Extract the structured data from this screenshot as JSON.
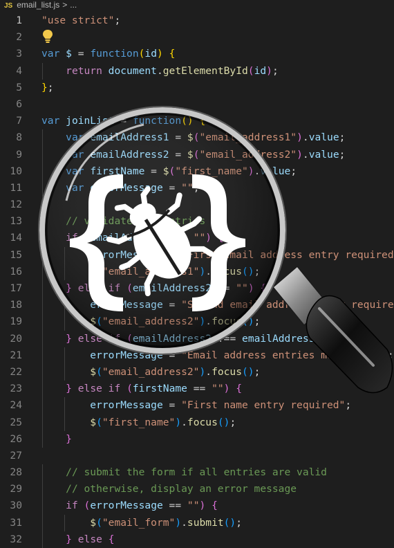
{
  "tab": {
    "lang_badge": "JS",
    "filename": "email_list.js",
    "chevron": ">",
    "breadcrumb_more": "..."
  },
  "icons": {
    "lightbulb": "lightbulb-icon",
    "magnifier": "magnifying-glass-icon",
    "bug": "bug-icon",
    "braces": "curly-braces-icon"
  },
  "colors": {
    "background": "#1e1e1e",
    "string": "#ce9178",
    "keyword": "#569cd6",
    "control": "#c586c0",
    "function": "#dcdcaa",
    "variable": "#9cdcfe",
    "comment": "#6a9955",
    "bracket1": "#ffd700",
    "bracket2": "#da70d6",
    "bracket3": "#179fff"
  },
  "editor": {
    "active_line": 1,
    "lines": [
      {
        "n": "1",
        "t": [
          [
            "str",
            "\"use strict\""
          ],
          [
            "pn",
            ";"
          ]
        ]
      },
      {
        "n": "2",
        "t": []
      },
      {
        "n": "3",
        "t": [
          [
            "kw",
            "var"
          ],
          [
            "pn",
            " "
          ],
          [
            "var",
            "$"
          ],
          [
            "pn",
            " = "
          ],
          [
            "kw",
            "function"
          ],
          [
            "br1",
            "("
          ],
          [
            "var",
            "id"
          ],
          [
            "br1",
            ")"
          ],
          [
            "pn",
            " "
          ],
          [
            "br1",
            "{"
          ]
        ]
      },
      {
        "n": "4",
        "t": [
          [
            "pn",
            "    "
          ],
          [
            "ctl",
            "return"
          ],
          [
            "pn",
            " "
          ],
          [
            "var",
            "document"
          ],
          [
            "pn",
            "."
          ],
          [
            "fn",
            "getElementById"
          ],
          [
            "br2",
            "("
          ],
          [
            "var",
            "id"
          ],
          [
            "br2",
            ")"
          ],
          [
            "pn",
            ";"
          ]
        ]
      },
      {
        "n": "5",
        "t": [
          [
            "br1",
            "}"
          ],
          [
            "pn",
            ";"
          ]
        ]
      },
      {
        "n": "6",
        "t": []
      },
      {
        "n": "7",
        "t": [
          [
            "kw",
            "var"
          ],
          [
            "pn",
            " "
          ],
          [
            "var",
            "joinList"
          ],
          [
            "pn",
            " = "
          ],
          [
            "kw",
            "function"
          ],
          [
            "br1",
            "()"
          ],
          [
            "pn",
            " "
          ],
          [
            "br1",
            "{"
          ]
        ]
      },
      {
        "n": "8",
        "t": [
          [
            "pn",
            "    "
          ],
          [
            "kw",
            "var"
          ],
          [
            "pn",
            " "
          ],
          [
            "var",
            "emailAddress1"
          ],
          [
            "pn",
            " = "
          ],
          [
            "fn",
            "$"
          ],
          [
            "br2",
            "("
          ],
          [
            "str",
            "\"email_address1\""
          ],
          [
            "br2",
            ")"
          ],
          [
            "pn",
            "."
          ],
          [
            "var",
            "value"
          ],
          [
            "pn",
            ";"
          ]
        ]
      },
      {
        "n": "9",
        "t": [
          [
            "pn",
            "    "
          ],
          [
            "kw",
            "var"
          ],
          [
            "pn",
            " "
          ],
          [
            "var",
            "emailAddress2"
          ],
          [
            "pn",
            " = "
          ],
          [
            "fn",
            "$"
          ],
          [
            "br2",
            "("
          ],
          [
            "str",
            "\"email_address2\""
          ],
          [
            "br2",
            ")"
          ],
          [
            "pn",
            "."
          ],
          [
            "var",
            "value"
          ],
          [
            "pn",
            ";"
          ]
        ]
      },
      {
        "n": "10",
        "t": [
          [
            "pn",
            "    "
          ],
          [
            "kw",
            "var"
          ],
          [
            "pn",
            " "
          ],
          [
            "var",
            "firstName"
          ],
          [
            "pn",
            " = "
          ],
          [
            "fn",
            "$"
          ],
          [
            "br2",
            "("
          ],
          [
            "str",
            "\"first_name\""
          ],
          [
            "br2",
            ")"
          ],
          [
            "pn",
            "."
          ],
          [
            "var",
            "value"
          ],
          [
            "pn",
            ";"
          ]
        ]
      },
      {
        "n": "11",
        "t": [
          [
            "pn",
            "    "
          ],
          [
            "kw",
            "var"
          ],
          [
            "pn",
            " "
          ],
          [
            "var",
            "errorMessage"
          ],
          [
            "pn",
            " = "
          ],
          [
            "str",
            "\"\""
          ],
          [
            "pn",
            ";"
          ]
        ]
      },
      {
        "n": "12",
        "t": []
      },
      {
        "n": "13",
        "t": [
          [
            "pn",
            "    "
          ],
          [
            "com",
            "// validate the entries"
          ]
        ]
      },
      {
        "n": "14",
        "t": [
          [
            "pn",
            "    "
          ],
          [
            "ctl",
            "if"
          ],
          [
            "pn",
            " "
          ],
          [
            "br2",
            "("
          ],
          [
            "var",
            "emailAddress1"
          ],
          [
            "pn",
            " == "
          ],
          [
            "str",
            "\"\""
          ],
          [
            "br2",
            ")"
          ],
          [
            "pn",
            " "
          ],
          [
            "br2",
            "{"
          ]
        ]
      },
      {
        "n": "15",
        "t": [
          [
            "pn",
            "        "
          ],
          [
            "var",
            "errorMessage"
          ],
          [
            "pn",
            " = "
          ],
          [
            "str",
            "\"First email address entry required\""
          ],
          [
            "pn",
            ";"
          ]
        ]
      },
      {
        "n": "16",
        "t": [
          [
            "pn",
            "        "
          ],
          [
            "fn",
            "$"
          ],
          [
            "br3",
            "("
          ],
          [
            "str",
            "\"email_address1\""
          ],
          [
            "br3",
            ")"
          ],
          [
            "pn",
            "."
          ],
          [
            "fn",
            "focus"
          ],
          [
            "br3",
            "()"
          ],
          [
            "pn",
            ";"
          ]
        ]
      },
      {
        "n": "17",
        "t": [
          [
            "pn",
            "    "
          ],
          [
            "br2",
            "}"
          ],
          [
            "pn",
            " "
          ],
          [
            "ctl",
            "else if"
          ],
          [
            "pn",
            " "
          ],
          [
            "br2",
            "("
          ],
          [
            "var",
            "emailAddress2"
          ],
          [
            "pn",
            " == "
          ],
          [
            "str",
            "\"\""
          ],
          [
            "br2",
            ")"
          ],
          [
            "pn",
            " "
          ],
          [
            "br2",
            "{"
          ]
        ]
      },
      {
        "n": "18",
        "t": [
          [
            "pn",
            "        "
          ],
          [
            "var",
            "errorMessage"
          ],
          [
            "pn",
            " = "
          ],
          [
            "str",
            "\"Second email address entry required\""
          ],
          [
            "pn",
            ";"
          ]
        ]
      },
      {
        "n": "19",
        "t": [
          [
            "pn",
            "        "
          ],
          [
            "fn",
            "$"
          ],
          [
            "br3",
            "("
          ],
          [
            "str",
            "\"email_address2\""
          ],
          [
            "br3",
            ")"
          ],
          [
            "pn",
            "."
          ],
          [
            "fn",
            "focus"
          ],
          [
            "br3",
            "()"
          ],
          [
            "pn",
            ";"
          ]
        ]
      },
      {
        "n": "20",
        "t": [
          [
            "pn",
            "    "
          ],
          [
            "br2",
            "}"
          ],
          [
            "pn",
            " "
          ],
          [
            "ctl",
            "else if"
          ],
          [
            "pn",
            " "
          ],
          [
            "br2",
            "("
          ],
          [
            "var",
            "emailAddress2"
          ],
          [
            "pn",
            " !== "
          ],
          [
            "var",
            "emailAddress1"
          ],
          [
            "br2",
            ")"
          ],
          [
            "pn",
            " "
          ],
          [
            "br2",
            "{"
          ]
        ]
      },
      {
        "n": "21",
        "t": [
          [
            "pn",
            "        "
          ],
          [
            "var",
            "errorMessage"
          ],
          [
            "pn",
            " = "
          ],
          [
            "str",
            "\"Email address entries must match\""
          ],
          [
            "pn",
            ";"
          ]
        ]
      },
      {
        "n": "22",
        "t": [
          [
            "pn",
            "        "
          ],
          [
            "fn",
            "$"
          ],
          [
            "br3",
            "("
          ],
          [
            "str",
            "\"email_address2\""
          ],
          [
            "br3",
            ")"
          ],
          [
            "pn",
            "."
          ],
          [
            "fn",
            "focus"
          ],
          [
            "br3",
            "()"
          ],
          [
            "pn",
            ";"
          ]
        ]
      },
      {
        "n": "23",
        "t": [
          [
            "pn",
            "    "
          ],
          [
            "br2",
            "}"
          ],
          [
            "pn",
            " "
          ],
          [
            "ctl",
            "else if"
          ],
          [
            "pn",
            " "
          ],
          [
            "br2",
            "("
          ],
          [
            "var",
            "firstName"
          ],
          [
            "pn",
            " == "
          ],
          [
            "str",
            "\"\""
          ],
          [
            "br2",
            ")"
          ],
          [
            "pn",
            " "
          ],
          [
            "br2",
            "{"
          ]
        ]
      },
      {
        "n": "24",
        "t": [
          [
            "pn",
            "        "
          ],
          [
            "var",
            "errorMessage"
          ],
          [
            "pn",
            " = "
          ],
          [
            "str",
            "\"First name entry required\""
          ],
          [
            "pn",
            ";"
          ]
        ]
      },
      {
        "n": "25",
        "t": [
          [
            "pn",
            "        "
          ],
          [
            "fn",
            "$"
          ],
          [
            "br3",
            "("
          ],
          [
            "str",
            "\"first_name\""
          ],
          [
            "br3",
            ")"
          ],
          [
            "pn",
            "."
          ],
          [
            "fn",
            "focus"
          ],
          [
            "br3",
            "()"
          ],
          [
            "pn",
            ";"
          ]
        ]
      },
      {
        "n": "26",
        "t": [
          [
            "pn",
            "    "
          ],
          [
            "br2",
            "}"
          ]
        ]
      },
      {
        "n": "27",
        "t": []
      },
      {
        "n": "28",
        "t": [
          [
            "pn",
            "    "
          ],
          [
            "com",
            "// submit the form if all entries are valid"
          ]
        ]
      },
      {
        "n": "29",
        "t": [
          [
            "pn",
            "    "
          ],
          [
            "com",
            "// otherwise, display an error message"
          ]
        ]
      },
      {
        "n": "30",
        "t": [
          [
            "pn",
            "    "
          ],
          [
            "ctl",
            "if"
          ],
          [
            "pn",
            " "
          ],
          [
            "br2",
            "("
          ],
          [
            "var",
            "errorMessage"
          ],
          [
            "pn",
            " == "
          ],
          [
            "str",
            "\"\""
          ],
          [
            "br2",
            ")"
          ],
          [
            "pn",
            " "
          ],
          [
            "br2",
            "{"
          ]
        ]
      },
      {
        "n": "31",
        "t": [
          [
            "pn",
            "        "
          ],
          [
            "fn",
            "$"
          ],
          [
            "br3",
            "("
          ],
          [
            "str",
            "\"email_form\""
          ],
          [
            "br3",
            ")"
          ],
          [
            "pn",
            "."
          ],
          [
            "fn",
            "submit"
          ],
          [
            "br3",
            "()"
          ],
          [
            "pn",
            ";"
          ]
        ]
      },
      {
        "n": "32",
        "t": [
          [
            "pn",
            "    "
          ],
          [
            "br2",
            "}"
          ],
          [
            "pn",
            " "
          ],
          [
            "ctl",
            "else"
          ],
          [
            "pn",
            " "
          ],
          [
            "br2",
            "{"
          ]
        ]
      }
    ]
  }
}
